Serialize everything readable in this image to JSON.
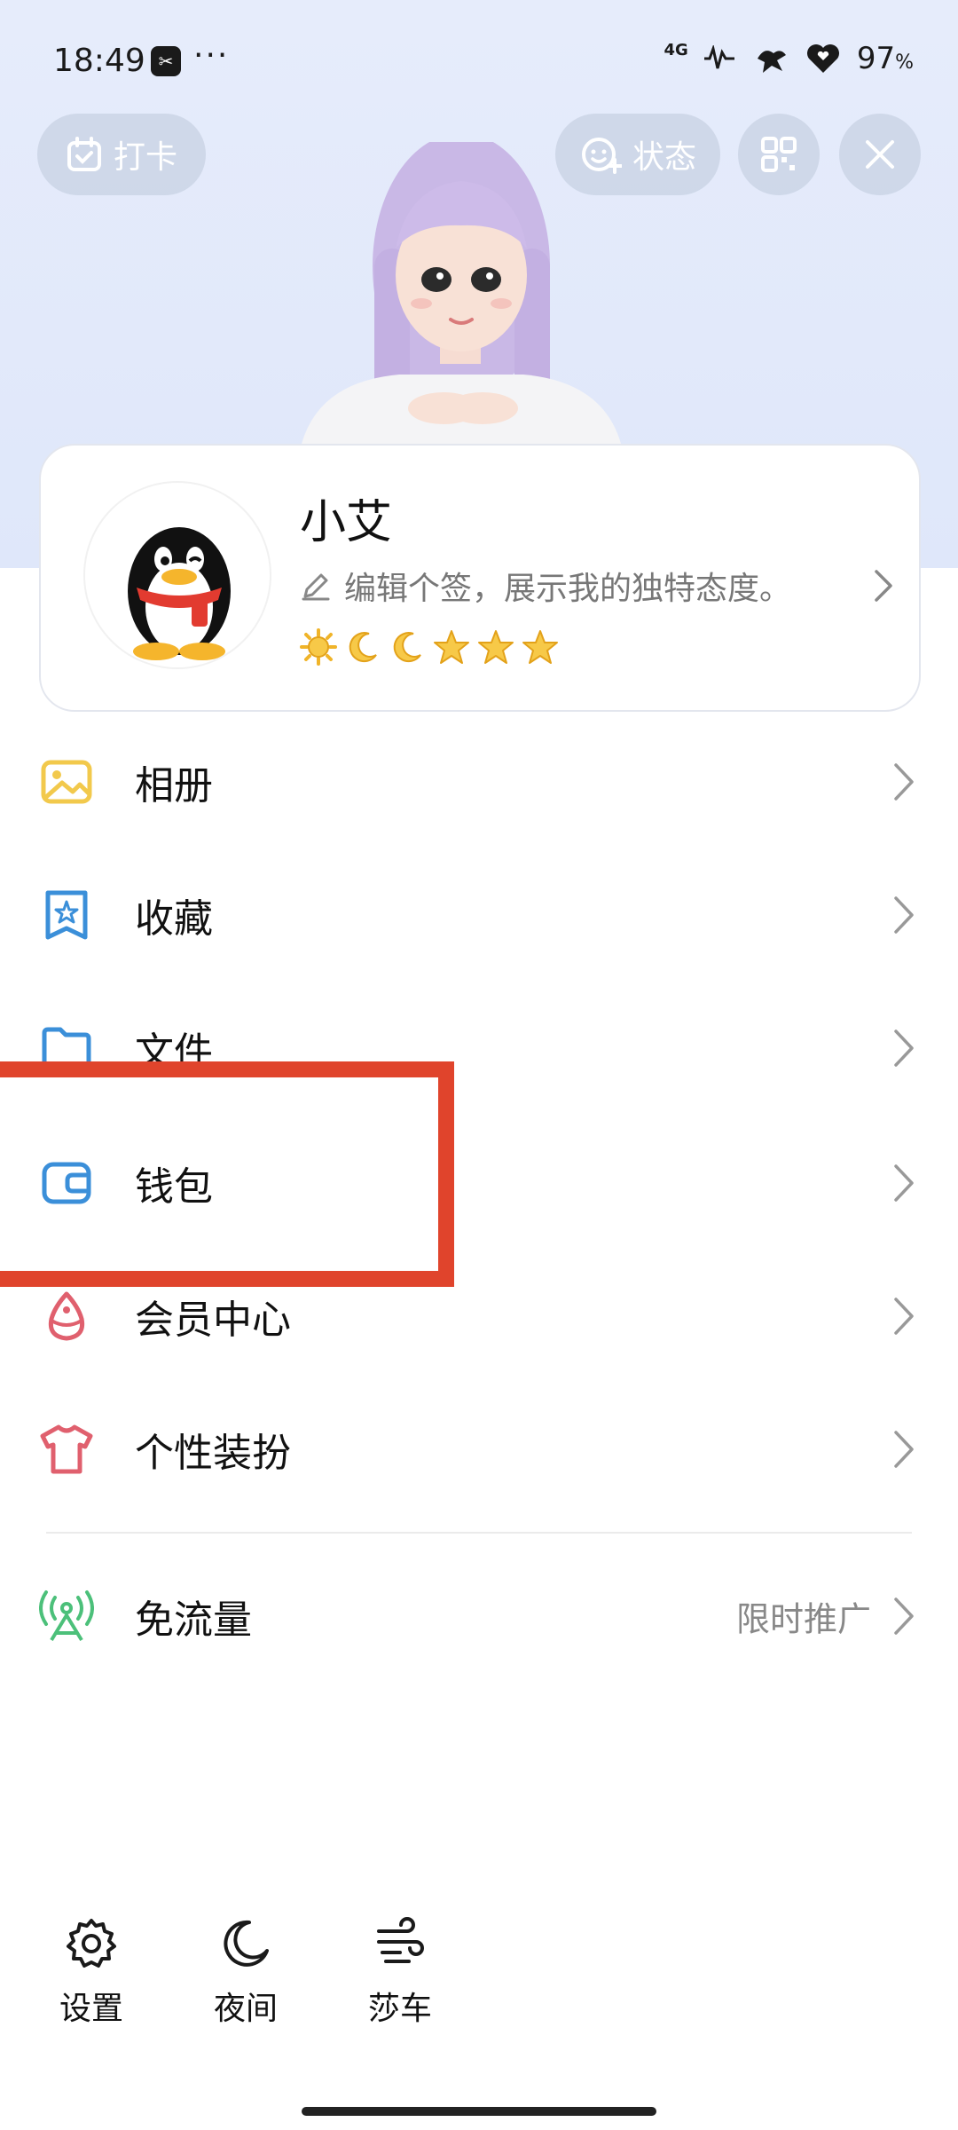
{
  "status_bar": {
    "time": "18:49",
    "app_badge": "✂",
    "dots": "···",
    "network": "4G",
    "battery": "97",
    "battery_unit": "%"
  },
  "header": {
    "checkin_label": "打卡",
    "status_label": "状态"
  },
  "profile": {
    "name": "小艾",
    "signature": "编辑个签，展示我的独特态度。",
    "level_icons": [
      "sun-icon",
      "moon-icon",
      "moon-icon",
      "star-icon",
      "star-icon",
      "star-icon"
    ]
  },
  "menu": {
    "items": [
      {
        "label": "相册",
        "icon": "photo-album-icon",
        "color": "#f2c94c"
      },
      {
        "label": "收藏",
        "icon": "favorites-icon",
        "color": "#3b8fd9"
      },
      {
        "label": "文件",
        "icon": "folder-icon",
        "color": "#3b8fd9"
      },
      {
        "label": "钱包",
        "icon": "wallet-icon",
        "color": "#3b8fd9"
      },
      {
        "label": "会员中心",
        "icon": "vip-icon",
        "color": "#e0606e"
      },
      {
        "label": "个性装扮",
        "icon": "tshirt-icon",
        "color": "#e0606e"
      },
      {
        "label": "免流量",
        "icon": "signal-tower-icon",
        "color": "#4cc07a",
        "extra": "限时推广"
      }
    ]
  },
  "bottom": {
    "settings_label": "设置",
    "night_label": "夜间",
    "shache_label": "莎车"
  },
  "colors": {
    "highlight": "#e0442c",
    "hero_bg": "#e6ecfb"
  }
}
